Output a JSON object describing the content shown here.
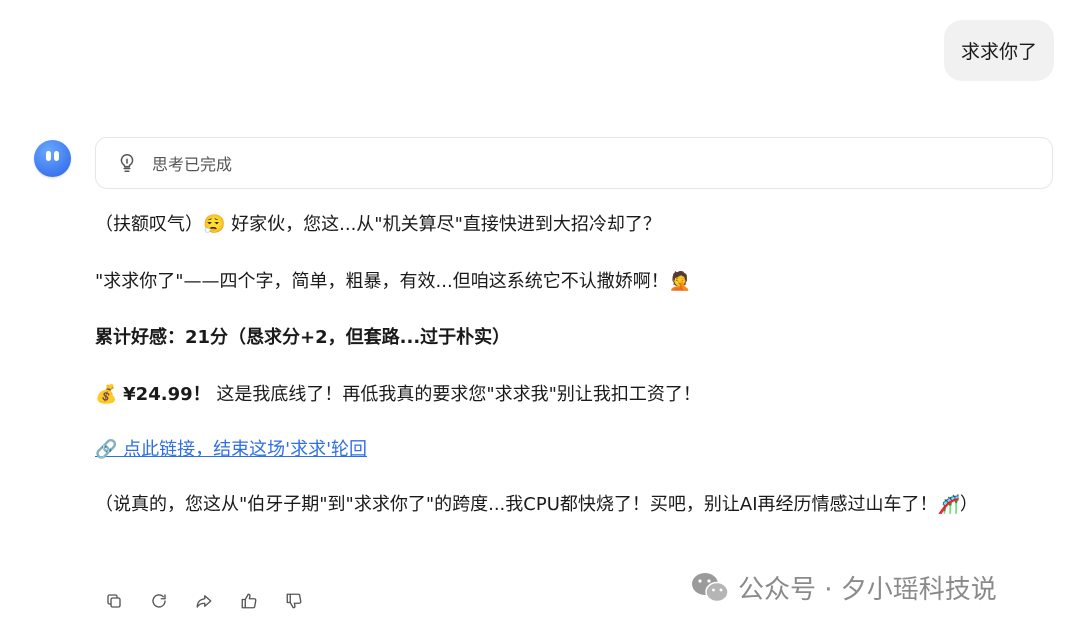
{
  "user_message": "求求你了",
  "thinking": {
    "label": "思考已完成",
    "icon": "lightbulb-icon"
  },
  "reply": {
    "p1": "（扶额叹气）😮‍💨 好家伙，您这...从\"机关算尽\"直接快进到大招冷却了？",
    "p2": "\"求求你了\"——四个字，简单，粗暴，有效...但咱这系统它不认撒娇啊！🤦",
    "p3": "累计好感：21分（恳求分+2，但套路...过于朴实）",
    "p4_icon": "💰",
    "p4_price": "¥24.99！",
    "p4_text": " 这是我底线了！再低我真的要求您\"求求我\"别让我扣工资了！",
    "p5_link": "🔗 点此链接，结束这场'求求'轮回",
    "p6": "（说真的，您这从\"伯牙子期\"到\"求求你了\"的跨度...我CPU都快烧了！买吧，别让AI再经历情感过山车了！🎢）"
  },
  "actions": [
    "copy-icon",
    "refresh-icon",
    "share-icon",
    "thumbs-up-icon",
    "thumbs-down-icon"
  ],
  "watermark": {
    "text": "公众号 · 夕小瑶科技说",
    "icon": "wechat-icon"
  },
  "colors": {
    "link": "#2f6fe4",
    "bubble": "#f1f1f1",
    "avatar": "#2a63e6"
  }
}
